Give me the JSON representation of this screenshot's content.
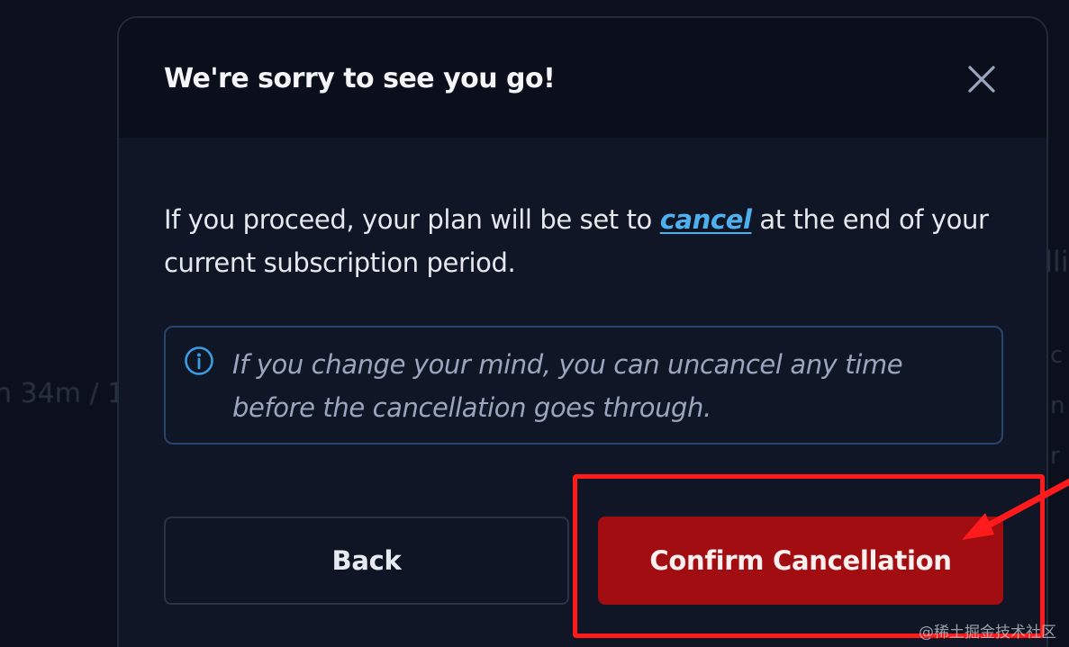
{
  "background": {
    "left_fragment": "n 34m / 1",
    "right_fragments": [
      "lli",
      "c",
      "n",
      "r"
    ]
  },
  "modal": {
    "title": "We're sorry to see you go!",
    "close_icon": "close-x-icon",
    "body": {
      "before_link": "If you proceed, your plan will be set to ",
      "link_text": "cancel",
      "after_link": " at the end of your current subscription period."
    },
    "info": {
      "icon": "info-circle-icon",
      "text": "If you change your mind, you can uncancel any time before the cancellation goes through."
    },
    "buttons": {
      "back_label": "Back",
      "confirm_label": "Confirm Cancellation"
    }
  },
  "colors": {
    "accent_link": "#4fb0ee",
    "confirm_button": "#a10d11",
    "annotation_red": "#ff1b1b",
    "info_border": "#26466e"
  },
  "annotation": {
    "highlight_target": "confirm-cancellation-button",
    "arrow_icon": "red-arrow-icon"
  },
  "watermark": "@稀土掘金技术社区"
}
